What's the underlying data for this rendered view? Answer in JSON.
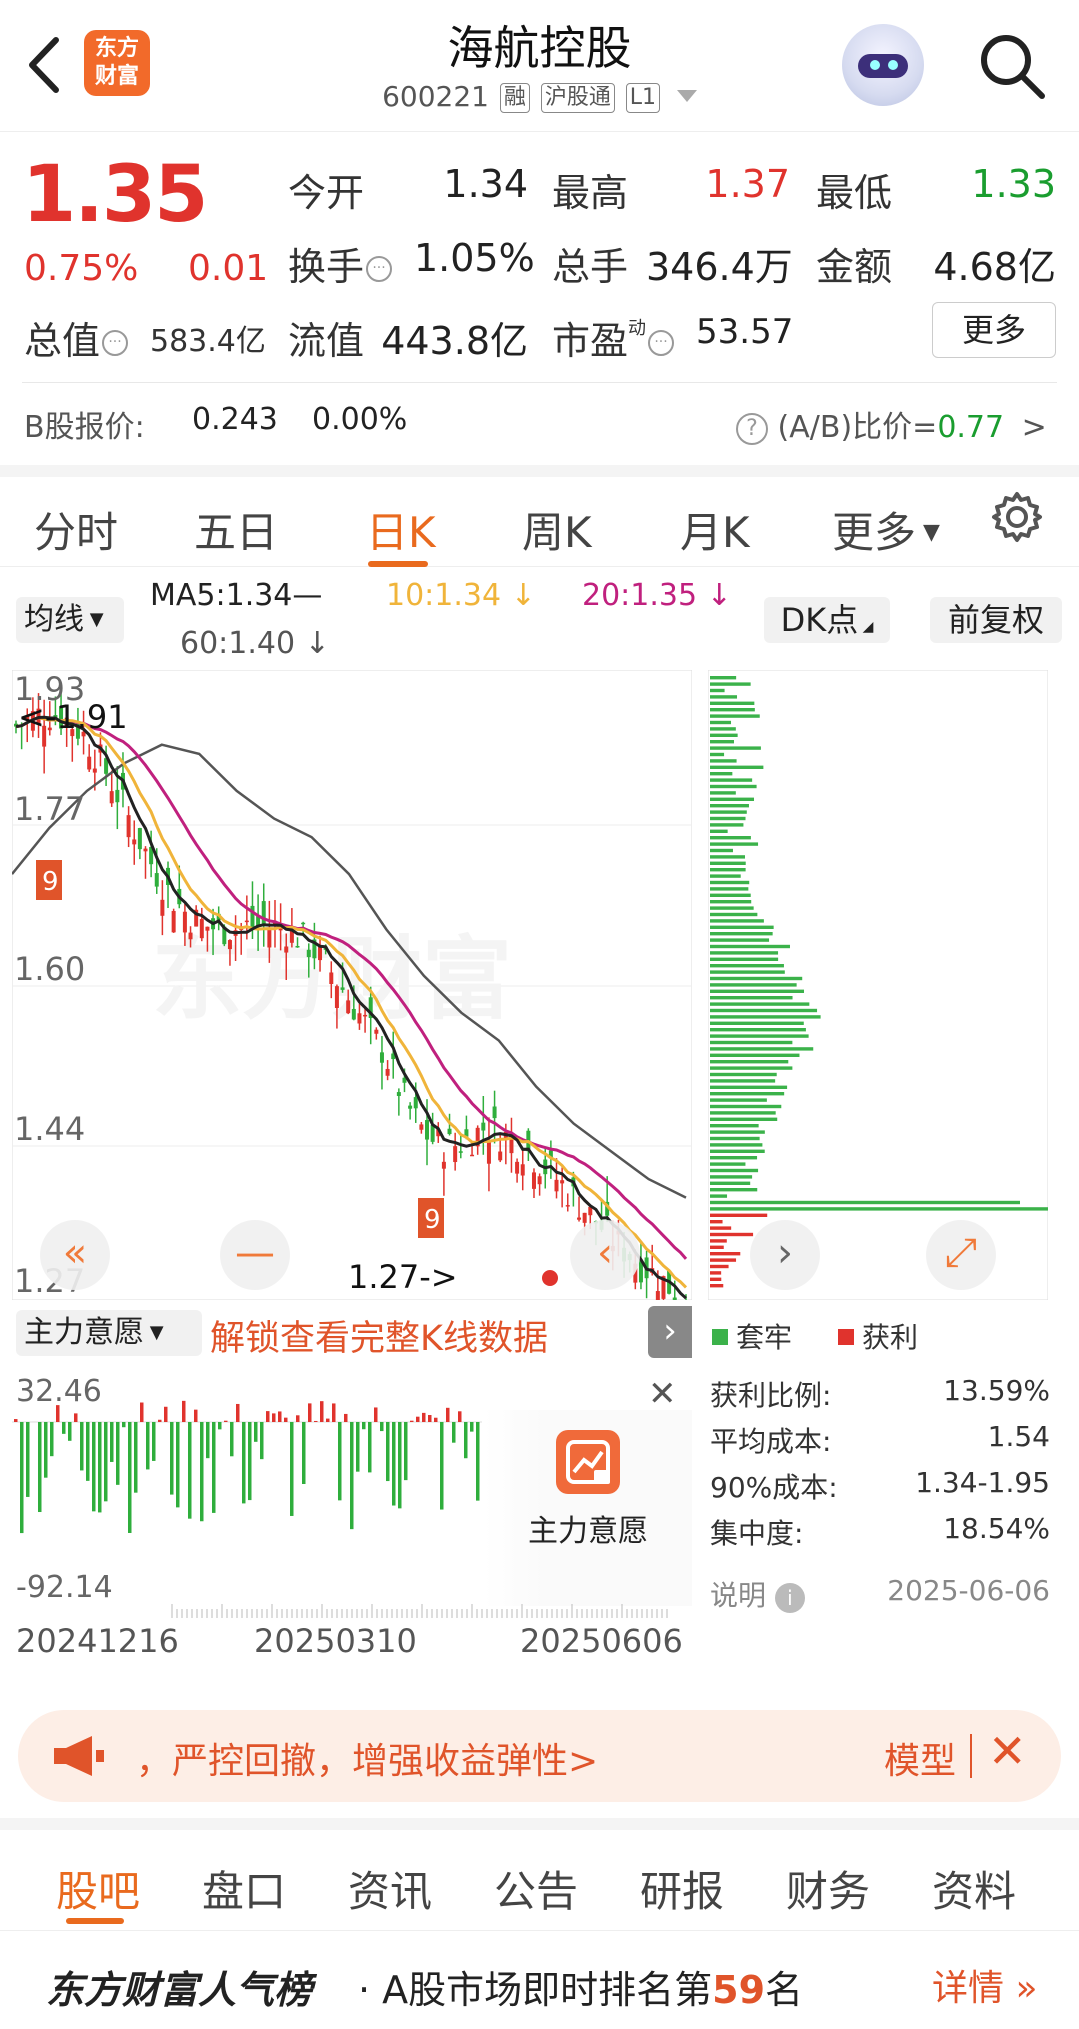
{
  "header": {
    "logo_text": "东方财富",
    "title": "海航控股",
    "code": "600221",
    "tags": [
      "融",
      "沪股通",
      "L1"
    ]
  },
  "quote": {
    "price": "1.35",
    "change_pct": "0.75%",
    "change": "0.01",
    "open_label": "今开",
    "open": "1.34",
    "high_label": "最高",
    "high": "1.37",
    "low_label": "最低",
    "low": "1.33",
    "turnover_label": "换手",
    "turnover": "1.05%",
    "volume_label": "总手",
    "volume": "346.4万",
    "amount_label": "金额",
    "amount": "4.68亿",
    "mktcap_label": "总值",
    "mktcap": "583.4亿",
    "float_label": "流值",
    "float": "443.8亿",
    "pe_label": "市盈",
    "pe_sup": "动",
    "pe": "53.57",
    "more_label": "更多",
    "b_label": "B股报价:",
    "b_price": "0.243",
    "b_pct": "0.00%",
    "ab_label": "(A/B)比价=",
    "ab_value": "0.77"
  },
  "colors": {
    "up": "#e0332d",
    "down": "#1a9d2f",
    "accent": "#e96a1e"
  },
  "period_tabs": [
    "分时",
    "五日",
    "日K",
    "周K",
    "月K",
    "更多"
  ],
  "active_period": "日K",
  "ma_bar": {
    "select": "均线",
    "ma5": "MA5:1.34—",
    "ma10": "10:1.34 ↓",
    "ma20": "20:1.35 ↓",
    "ma60": "60:1.40 ↓",
    "dk": "DK点",
    "fq": "前复权"
  },
  "chart_data": {
    "type": "candlestick",
    "price_labels": [
      "1.93",
      "1.77",
      "1.60",
      "1.44",
      "1.27"
    ],
    "annotations": [
      "<-1.91",
      "1.27->"
    ],
    "x_labels": [
      "20241216",
      "20250310",
      "20250606"
    ],
    "ylim": [
      1.27,
      1.93
    ],
    "ma_colors": {
      "ma5": "#222222",
      "ma10": "#f0b43a",
      "ma20": "#c0207e",
      "ma60": "#555555"
    },
    "ma60_path": [
      1.72,
      1.77,
      1.81,
      1.84,
      1.86,
      1.85,
      1.81,
      1.78,
      1.76,
      1.72,
      1.66,
      1.61,
      1.57,
      1.54,
      1.49,
      1.45,
      1.42,
      1.39,
      1.37
    ]
  },
  "chip": {
    "legend_trapped": "套牢",
    "legend_profit": "获利",
    "rows": [
      {
        "label": "获利比例:",
        "value": "13.59%"
      },
      {
        "label": "平均成本:",
        "value": "1.54"
      },
      {
        "label": "90%成本:",
        "value": "1.34-1.95"
      },
      {
        "label": "集中度:",
        "value": "18.54%"
      }
    ],
    "note_label": "说明",
    "date": "2025-06-06"
  },
  "indicator": {
    "select": "主力意愿",
    "unlock_text": "解锁查看完整K线数据",
    "top_value": "32.46",
    "bottom_value": "-92.14",
    "lock_label": "主力意愿"
  },
  "banner": {
    "text": "，严控回撤，增强收益弹性>",
    "model": "模型"
  },
  "bottom_tabs": [
    "股吧",
    "盘口",
    "资讯",
    "公告",
    "研报",
    "财务",
    "资料"
  ],
  "ranking": {
    "brand": "东方财富人气榜",
    "prefix": "· A股市场即时排名第",
    "rank": "59",
    "suffix": "名",
    "detail": "详情"
  }
}
